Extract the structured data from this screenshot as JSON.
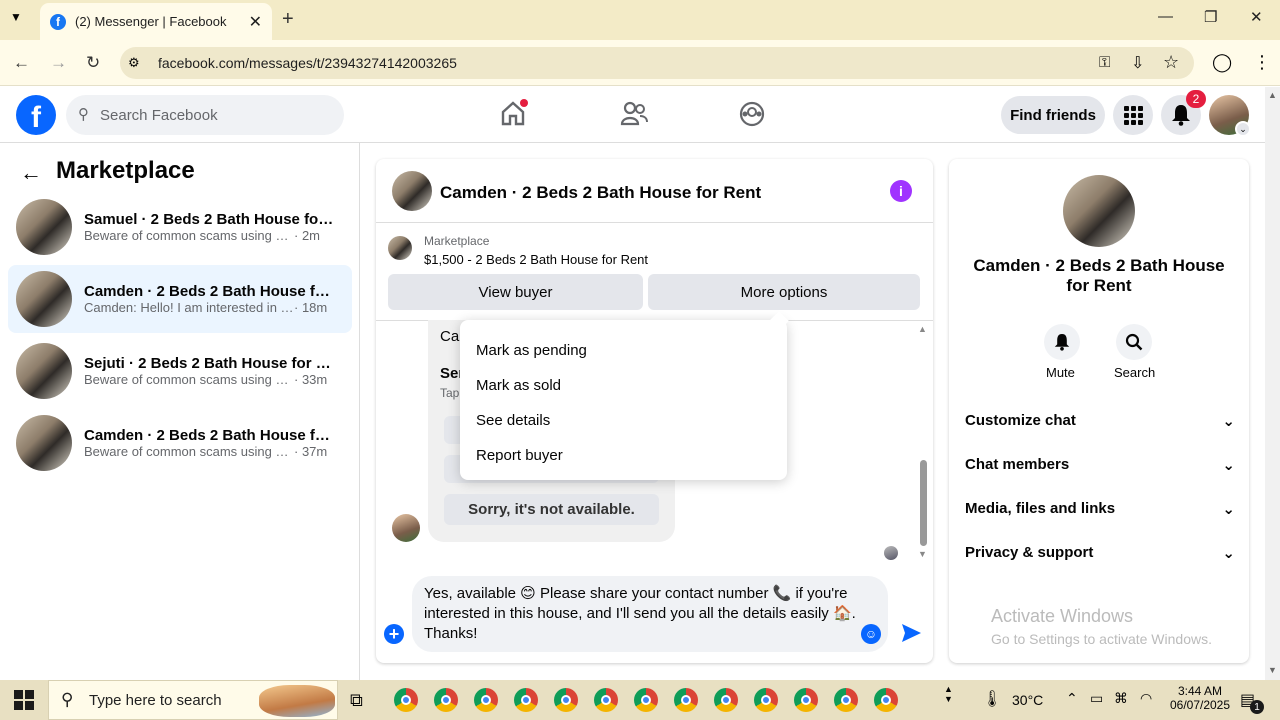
{
  "browser": {
    "tab_title": "(2) Messenger | Facebook",
    "url": "facebook.com/messages/t/23943274142003265"
  },
  "fb": {
    "search_placeholder": "Search Facebook",
    "find_friends": "Find friends",
    "notif_count": "2"
  },
  "left": {
    "title": "Marketplace",
    "conversations": [
      {
        "title": "Samuel · 2 Beds 2 Bath House for ...",
        "preview": "Beware of common scams using pay...",
        "time": "· 2m"
      },
      {
        "title": "Camden · 2 Beds 2 Bath House for...",
        "preview": "Camden: Hello! I am interested in y...",
        "time": "· 18m"
      },
      {
        "title": "Sejuti · 2 Beds 2 Bath House for Re...",
        "preview": "Beware of common scams using pa...",
        "time": "· 33m"
      },
      {
        "title": "Camden · 2 Beds 2 Bath House for...",
        "preview": "Beware of common scams using pa...",
        "time": "· 37m"
      }
    ]
  },
  "chat": {
    "title": "Camden · 2 Beds 2 Bath House for Rent",
    "marketplace_label": "Marketplace",
    "listing": "$1,500 - 2 Beds 2 Bath House for Rent",
    "view_buyer": "View buyer",
    "more_options": "More options",
    "partial1": "Car",
    "partial2": "Sen",
    "partial3": "Tap",
    "sorry": "Sorry, it's not available.",
    "menu": [
      "Mark as pending",
      "Mark as sold",
      "See details",
      "Report buyer"
    ],
    "composer_text": "Yes, available 😊 Please share your contact number 📞 if you're interested in this house, and I'll send you all the details easily 🏠. Thanks!"
  },
  "right": {
    "title": "Camden · 2 Beds 2 Bath House for Rent",
    "mute": "Mute",
    "search": "Search",
    "sections": [
      "Customize chat",
      "Chat members",
      "Media, files and links",
      "Privacy & support"
    ],
    "watermark_title": "Activate Windows",
    "watermark_sub": "Go to Settings to activate Windows."
  },
  "taskbar": {
    "search_placeholder": "Type here to search",
    "temperature": "30°C",
    "time": "3:44 AM",
    "date": "06/07/2025",
    "notif_count": "1"
  }
}
